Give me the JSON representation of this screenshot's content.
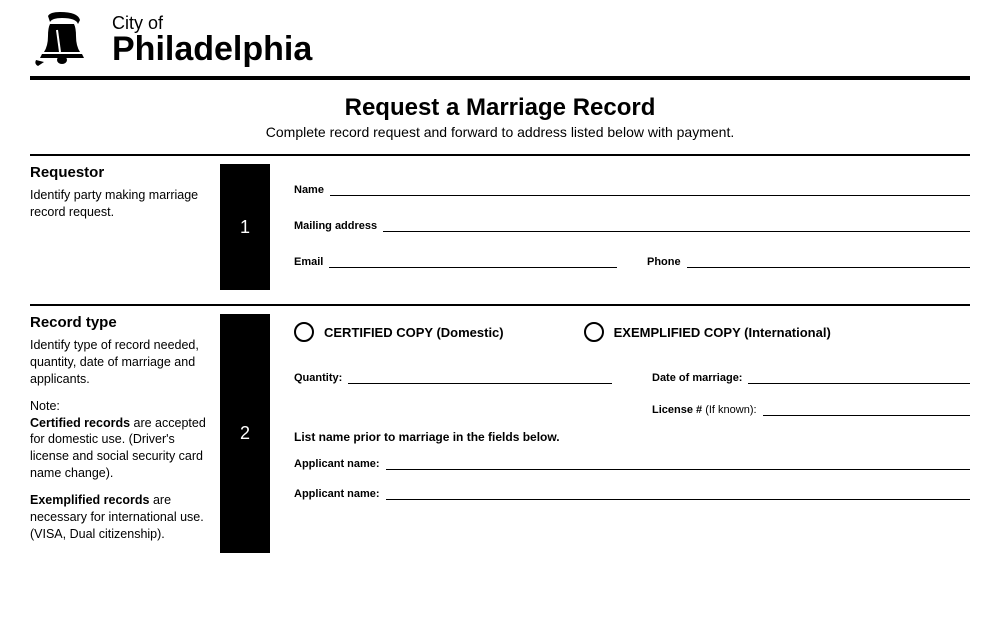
{
  "logo": {
    "city_of": "City of",
    "phila": "Philadelphia"
  },
  "title": "Request a Marriage Record",
  "subtitle": "Complete record request and forward to address listed below with payment.",
  "section1": {
    "num": "1",
    "heading": "Requestor",
    "desc": "Identify party making marriage record request.",
    "fields": {
      "name": "Name",
      "mailing": "Mailing address",
      "email": "Email",
      "phone": "Phone"
    }
  },
  "section2": {
    "num": "2",
    "heading": "Record type",
    "desc": "Identify type of record needed, quantity, date of marriage and applicants.",
    "note_label": "Note:",
    "note_cert_bold": "Certified records",
    "note_cert_rest": " are accepted for domestic use. (Driver's license and social security card name change).",
    "note_exem_bold": "Exemplified records",
    "note_exem_rest": " are necessary for international use. (VISA, Dual citizenship).",
    "radio_certified": "CERTIFIED COPY (Domestic)",
    "radio_exemplified": "EXEMPLIFIED COPY (International)",
    "quantity": "Quantity:",
    "date_marriage": "Date of marriage:",
    "license_bold": "License #",
    "license_rest": " (If known):",
    "list_instr": "List name prior to marriage in the fields below.",
    "applicant": "Applicant name:"
  }
}
